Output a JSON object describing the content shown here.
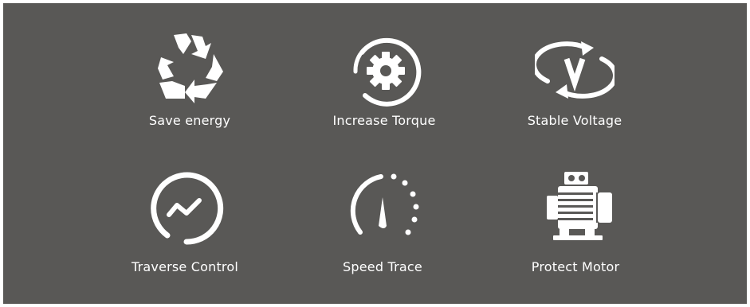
{
  "colors": {
    "background": "#595856",
    "foreground": "#ffffff"
  },
  "features": [
    {
      "label": "Save energy",
      "icon": "recycle-icon"
    },
    {
      "label": "Increase Torque",
      "icon": "gear-icon"
    },
    {
      "label": "Stable Voltage",
      "icon": "voltage-cycle-icon"
    },
    {
      "label": "Traverse Control",
      "icon": "trend-circle-icon"
    },
    {
      "label": "Speed Trace",
      "icon": "speedometer-icon"
    },
    {
      "label": "Protect Motor",
      "icon": "motor-icon"
    }
  ]
}
